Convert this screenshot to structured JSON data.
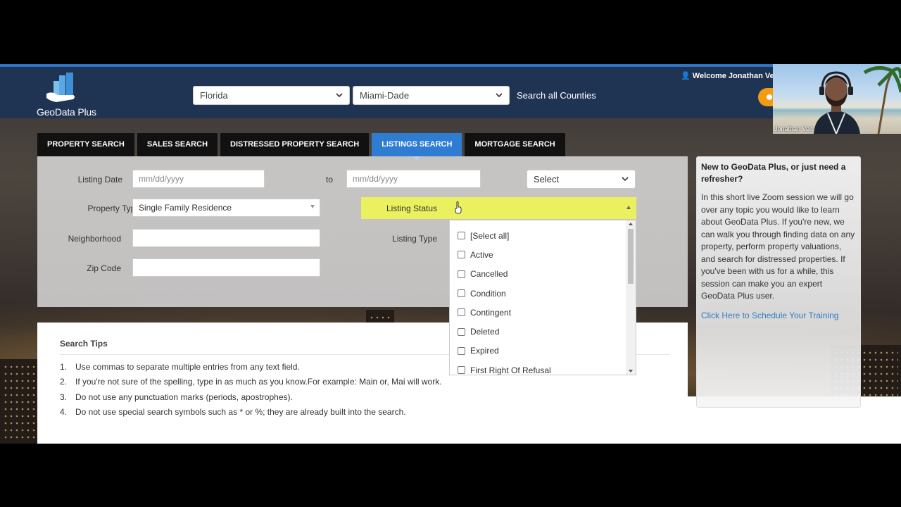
{
  "header": {
    "logo_text": "GeoData Plus",
    "state_select": "Florida",
    "county_select": "Miami-Dade",
    "search_all_counties": "Search all Counties",
    "welcome": "Welcome Jonathan Veit"
  },
  "video": {
    "name": "Jonathan Veit"
  },
  "tabs": [
    {
      "label": "PROPERTY SEARCH",
      "active": false
    },
    {
      "label": "SALES SEARCH",
      "active": false
    },
    {
      "label": "DISTRESSED PROPERTY SEARCH",
      "active": false
    },
    {
      "label": "LISTINGS SEARCH",
      "active": true
    },
    {
      "label": "MORTGAGE SEARCH",
      "active": false
    }
  ],
  "form": {
    "listing_date_label": "Listing Date",
    "date_from_placeholder": "mm/dd/yyyy",
    "to_label": "to",
    "date_to_placeholder": "mm/dd/yyyy",
    "date_range_select": "Select",
    "property_type_label": "Property Type",
    "property_type_value": "Single Family Residence",
    "listing_status_label": "Listing Status",
    "neighborhood_label": "Neighborhood",
    "listing_type_label": "Listing Type",
    "zip_code_label": "Zip Code"
  },
  "status_options": [
    "[Select all]",
    "Active",
    "Cancelled",
    "Condition",
    "Contingent",
    "Deleted",
    "Expired",
    "First Right Of Refusal"
  ],
  "tips": {
    "title": "Search Tips",
    "items": [
      {
        "num": "1.",
        "text": "Use commas to separate multiple entries from any text field."
      },
      {
        "num": "2.",
        "text": "If you're not sure of the spelling, type in as much as you know.For example: Main or, Mai will work."
      },
      {
        "num": "3.",
        "text": "Do not use any punctuation marks (periods, apostrophes)."
      },
      {
        "num": "4.",
        "text": "Do not use special search symbols such as * or %; they are already built into the search."
      }
    ]
  },
  "sidebar": {
    "title": "New to GeoData Plus, or just need a refresher?",
    "body": "In this short live Zoom session we will go over any topic you would like to learn about GeoData Plus. If you're new, we can walk you through finding data on any property, perform property valuations, and search for distressed properties. If you've been with us for a while, this session can make you an expert GeoData Plus user.",
    "link": "Click Here to Schedule Your Training"
  },
  "colors": {
    "header_bg": "#1f3353",
    "accent_blue": "#2f7cd3",
    "highlight_yellow": "#eaf05e",
    "orange": "#f39c12"
  }
}
